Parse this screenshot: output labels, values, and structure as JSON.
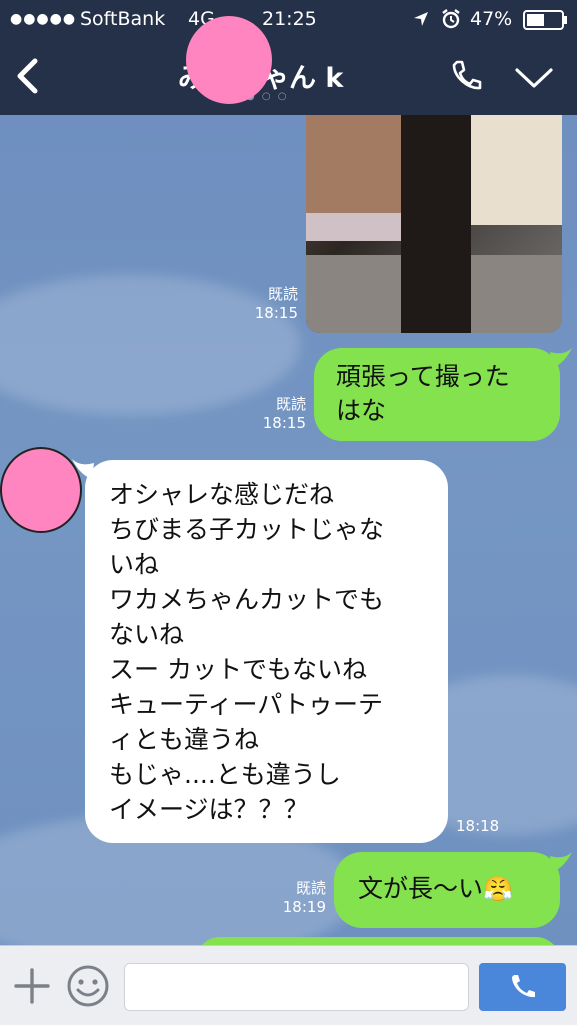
{
  "status_bar": {
    "signal": "●●●●●",
    "carrier": "SoftBank",
    "network": "4G",
    "time": "21:25",
    "battery": "47%"
  },
  "header": {
    "title_left": "み",
    "title_right": "ゃん k",
    "page_dots": "● ○ ○"
  },
  "messages": [
    {
      "type": "image",
      "side": "right",
      "read_label": "既読",
      "time": "18:15"
    },
    {
      "type": "text",
      "side": "right",
      "lines": [
        "頑張って撮った",
        "はな"
      ],
      "read_label": "既読",
      "time": "18:15"
    },
    {
      "type": "text",
      "side": "left",
      "lines": [
        "オシャレな感じだね",
        "ちびまる子カットじゃな",
        "いね",
        "ワカメちゃんカットでも",
        "ないね",
        "スー カットでもないね",
        "キューティーパトゥーテ",
        "ィとも違うね",
        "もじゃ....とも違うし",
        "イメージは？？？"
      ],
      "time": "18:18"
    },
    {
      "type": "text",
      "side": "right",
      "text": "文が長〜い",
      "emoji": "😤",
      "read_label": "既読",
      "time": "18:19"
    }
  ],
  "input_bar": {
    "placeholder": ""
  },
  "colors": {
    "nav": "#253149",
    "sent_bubble": "#84e24f",
    "received_bubble": "#ffffff",
    "redaction": "#ff85c0",
    "send_button": "#4a86d9"
  }
}
